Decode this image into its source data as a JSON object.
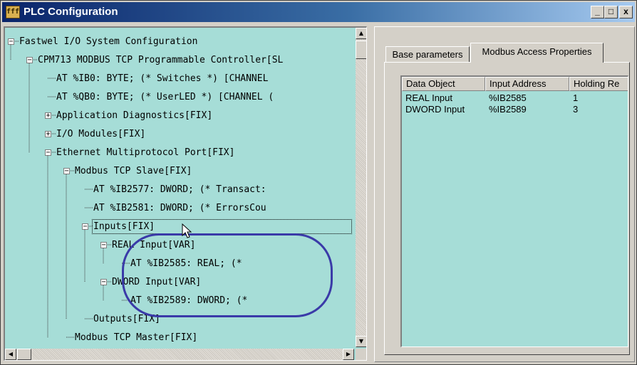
{
  "window": {
    "title": "PLC Configuration",
    "icon_text": "fff",
    "controls": {
      "minimize": "_",
      "maximize": "□",
      "close": "x"
    }
  },
  "tree": {
    "expander_open": "−",
    "expander_closed": "+",
    "nodes": [
      {
        "text": "Fastwel I/O System Configuration",
        "expander": "open"
      },
      {
        "text": "CPM713 MODBUS TCP Programmable Controller[SL",
        "expander": "open"
      },
      {
        "text": "AT %IB0: BYTE; (* Switches *) [CHANNEL",
        "expander": "none"
      },
      {
        "text": "AT %QB0: BYTE; (* UserLED *) [CHANNEL (",
        "expander": "none"
      },
      {
        "text": "Application Diagnostics[FIX]",
        "expander": "closed"
      },
      {
        "text": "I/O Modules[FIX]",
        "expander": "closed"
      },
      {
        "text": "Ethernet Multiprotocol Port[FIX]",
        "expander": "open"
      },
      {
        "text": "Modbus TCP Slave[FIX]",
        "expander": "open"
      },
      {
        "text": "AT %IB2577: DWORD; (* Transact:",
        "expander": "none"
      },
      {
        "text": "AT %IB2581: DWORD; (* ErrorsCou",
        "expander": "none"
      },
      {
        "text": "Inputs[FIX]",
        "expander": "open",
        "focused": true
      },
      {
        "text": "REAL Input[VAR]",
        "expander": "open"
      },
      {
        "text": "AT %IB2585: REAL; (*",
        "expander": "none"
      },
      {
        "text": "DWORD Input[VAR]",
        "expander": "open"
      },
      {
        "text": "AT %IB2589: DWORD; (*",
        "expander": "none"
      },
      {
        "text": "Outputs[FIX]",
        "expander": "none"
      },
      {
        "text": "Modbus TCP Master[FIX]",
        "expander": "none"
      }
    ],
    "scroll_arrows": {
      "up": "▲",
      "down": "▼",
      "left": "◀",
      "right": "▶"
    }
  },
  "properties_panel": {
    "tabs": [
      {
        "label": "Base parameters",
        "active": false
      },
      {
        "label": "Modbus Access Properties",
        "active": true
      }
    ],
    "table": {
      "columns": [
        "Data Object",
        "Input Address",
        "Holding Re"
      ],
      "rows": [
        [
          "REAL Input",
          "%IB2585",
          "1"
        ],
        [
          "DWORD Input",
          "%IB2589",
          "3"
        ]
      ]
    }
  },
  "colors": {
    "tree_background": "#a6ddd7",
    "title_bar": "#0a246a",
    "highlight_ellipse": "#3a3aa8"
  }
}
